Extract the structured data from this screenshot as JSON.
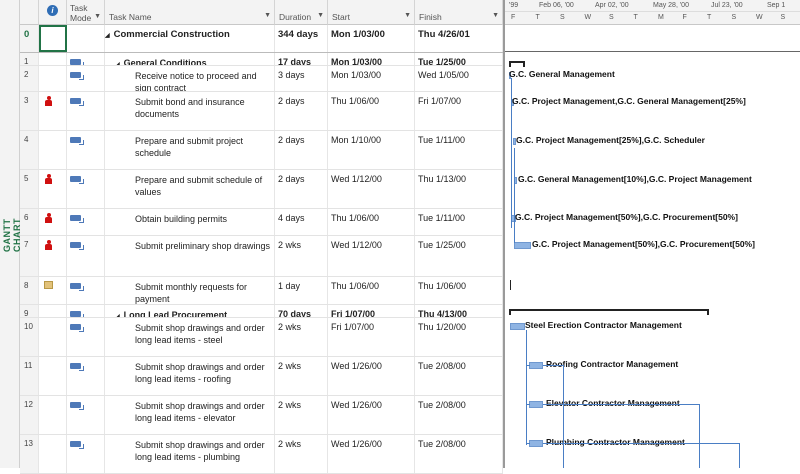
{
  "sidebar": {
    "view_label": "GANTT CHART"
  },
  "columns": {
    "info_icon": "info-icon",
    "task_mode": "Task Mode",
    "task_name": "Task Name",
    "duration": "Duration",
    "start": "Start",
    "finish": "Finish"
  },
  "timescale": {
    "top": [
      "'99",
      "Feb 06, '00",
      "Apr 02, '00",
      "May 28, '00",
      "Jul 23, '00",
      "Sep 1"
    ],
    "bottom": [
      "F",
      "T",
      "S",
      "W",
      "S",
      "T",
      "M",
      "F",
      "T",
      "S",
      "W",
      "S"
    ]
  },
  "tasks": [
    {
      "id": "0",
      "name": "Commercial Construction",
      "duration": "344 days",
      "start": "Mon 1/03/00",
      "finish": "Thu 4/26/01",
      "summary": true,
      "indicator": ""
    },
    {
      "id": "1",
      "name": "General Conditions",
      "duration": "17 days",
      "start": "Mon 1/03/00",
      "finish": "Tue 1/25/00",
      "summary": true,
      "indicator": ""
    },
    {
      "id": "2",
      "name": "Receive notice to proceed and sign contract",
      "duration": "3 days",
      "start": "Mon 1/03/00",
      "finish": "Wed 1/05/00",
      "summary": false,
      "indicator": ""
    },
    {
      "id": "3",
      "name": "Submit bond and insurance documents",
      "duration": "2 days",
      "start": "Thu 1/06/00",
      "finish": "Fri 1/07/00",
      "summary": false,
      "indicator": "person"
    },
    {
      "id": "4",
      "name": "Prepare and submit project schedule",
      "duration": "2 days",
      "start": "Mon 1/10/00",
      "finish": "Tue 1/11/00",
      "summary": false,
      "indicator": ""
    },
    {
      "id": "5",
      "name": "Prepare and submit schedule of values",
      "duration": "2 days",
      "start": "Wed 1/12/00",
      "finish": "Thu 1/13/00",
      "summary": false,
      "indicator": "person"
    },
    {
      "id": "6",
      "name": "Obtain building permits",
      "duration": "4 days",
      "start": "Thu 1/06/00",
      "finish": "Tue 1/11/00",
      "summary": false,
      "indicator": "person"
    },
    {
      "id": "7",
      "name": "Submit preliminary shop drawings",
      "duration": "2 wks",
      "start": "Wed 1/12/00",
      "finish": "Tue 1/25/00",
      "summary": false,
      "indicator": "person"
    },
    {
      "id": "8",
      "name": "Submit monthly requests for payment",
      "duration": "1 day",
      "start": "Thu 1/06/00",
      "finish": "Thu 1/06/00",
      "summary": false,
      "indicator": "note"
    },
    {
      "id": "9",
      "name": "Long Lead Procurement",
      "duration": "70 days",
      "start": "Fri 1/07/00",
      "finish": "Thu 4/13/00",
      "summary": true,
      "indicator": ""
    },
    {
      "id": "10",
      "name": "Submit shop drawings and order long lead items - steel",
      "duration": "2 wks",
      "start": "Fri 1/07/00",
      "finish": "Thu 1/20/00",
      "summary": false,
      "indicator": ""
    },
    {
      "id": "11",
      "name": "Submit shop drawings and order long lead items - roofing",
      "duration": "2 wks",
      "start": "Wed 1/26/00",
      "finish": "Tue 2/08/00",
      "summary": false,
      "indicator": ""
    },
    {
      "id": "12",
      "name": "Submit shop drawings and order long lead items - elevator",
      "duration": "2 wks",
      "start": "Wed 1/26/00",
      "finish": "Tue 2/08/00",
      "summary": false,
      "indicator": ""
    },
    {
      "id": "13",
      "name": "Submit shop drawings and order long lead items - plumbing",
      "duration": "2 wks",
      "start": "Wed 1/26/00",
      "finish": "Tue 2/08/00",
      "summary": false,
      "indicator": ""
    }
  ],
  "resources": {
    "r2": "G.C. General Management",
    "r3": "G.C. Project Management,G.C. General Management[25%]",
    "r4": "G.C. Project Management[25%],G.C. Scheduler",
    "r5": "G.C. General Management[10%],G.C. Project Management",
    "r6": "G.C. Project Management[50%],G.C. Procurement[50%]",
    "r7": "G.C. Project Management[50%],G.C. Procurement[50%]",
    "r10": "Steel Erection Contractor Management",
    "r11": "Roofing Contractor Management",
    "r12": "Elevator Contractor Management",
    "r13": "Plumbing Contractor Management"
  },
  "colors": {
    "accent_green": "#217346",
    "bar_blue": "#8fb4e3",
    "link_blue": "#4a7ec4",
    "alert_red": "#d01010"
  }
}
